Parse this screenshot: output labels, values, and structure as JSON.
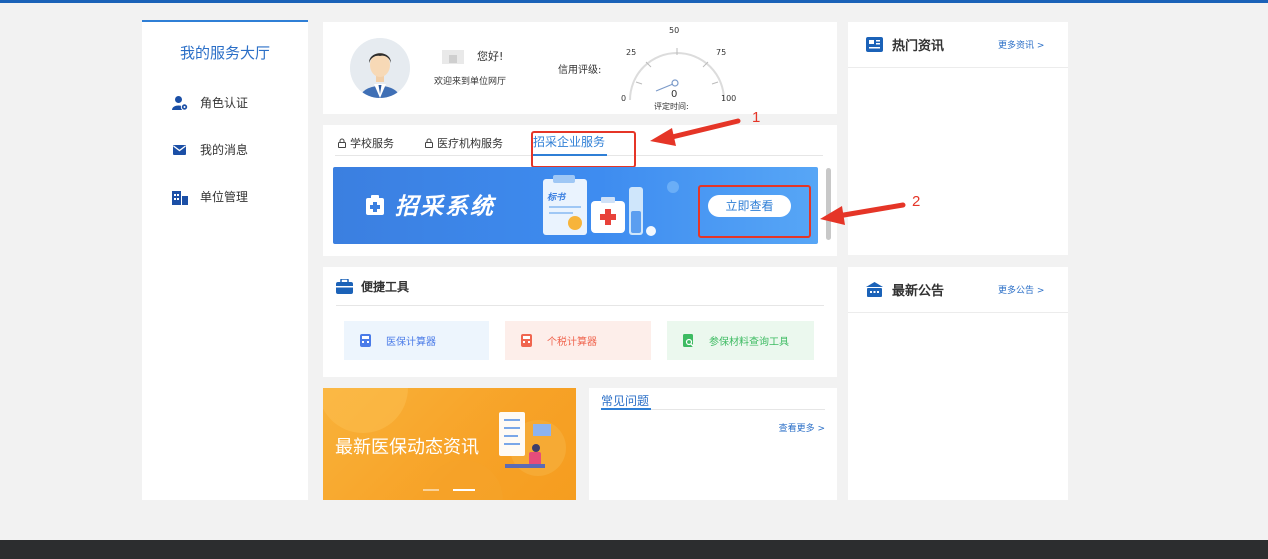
{
  "sidebar": {
    "title": "我的服务大厅",
    "items": [
      {
        "label": "角色认证",
        "icon": "user-role-icon"
      },
      {
        "label": "我的消息",
        "icon": "mail-icon"
      },
      {
        "label": "单位管理",
        "icon": "building-icon"
      }
    ]
  },
  "profile": {
    "greeting": "您好!",
    "welcome": "欢迎来到单位网厅",
    "credit_label": "信用评级:",
    "gauge": {
      "ticks": [
        "0",
        "25",
        "50",
        "75",
        "100"
      ],
      "value": "0",
      "eval_time_label": "评定时间:"
    }
  },
  "service": {
    "tabs": [
      {
        "label": "学校服务",
        "locked": true
      },
      {
        "label": "医疗机构服务",
        "locked": true
      },
      {
        "label": "招采企业服务",
        "active": true
      }
    ],
    "banner": {
      "title": "招采系统",
      "doc_label": "标书",
      "button": "立即查看"
    }
  },
  "tools": {
    "title": "便捷工具",
    "items": [
      {
        "label": "医保计算器",
        "icon": "calculator-icon",
        "color": "#4a7be8",
        "bg": "#edf5fd"
      },
      {
        "label": "个税计算器",
        "icon": "calculator-icon",
        "color": "#f0654f",
        "bg": "#fdeeea"
      },
      {
        "label": "参保材料查询工具",
        "icon": "document-search-icon",
        "color": "#3dbb62",
        "bg": "#ebf8ee"
      }
    ]
  },
  "news_banner": {
    "text": "最新医保动态资讯"
  },
  "faq": {
    "title": "常见问题",
    "more": "查看更多 >"
  },
  "hot_news": {
    "title": "热门资讯",
    "more": "更多资讯 >"
  },
  "announcements": {
    "title": "最新公告",
    "more": "更多公告 >"
  },
  "annotations": {
    "one": "1",
    "two": "2"
  },
  "colors": {
    "accent": "#2f7fd6",
    "highlight": "#e53527",
    "footer": "#2c2d2f"
  }
}
